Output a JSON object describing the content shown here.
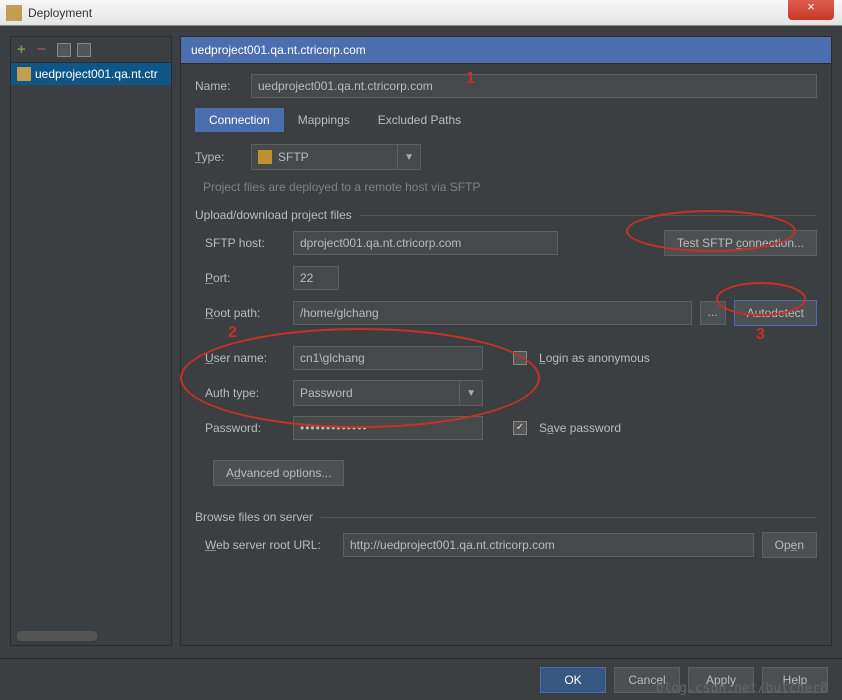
{
  "window": {
    "title": "Deployment",
    "close": "×"
  },
  "sidebar": {
    "toolbar": {
      "add": "+",
      "remove": "−"
    },
    "item": "uedproject001.qa.nt.ctr"
  },
  "header": {
    "title": "uedproject001.qa.nt.ctricorp.com"
  },
  "form": {
    "name_label": "Name:",
    "name_value": "uedproject001.qa.nt.ctricorp.com",
    "tabs": {
      "connection": "Connection",
      "mappings": "Mappings",
      "excluded": "Excluded Paths"
    },
    "type_label": "Type:",
    "type_value": "SFTP",
    "type_hint": "Project files are deployed to a remote host via SFTP",
    "upload_legend": "Upload/download project files",
    "host_label": "SFTP host:",
    "host_value": "dproject001.qa.nt.ctricorp.com",
    "test_btn": "Test SFTP connection...",
    "port_label": "Port:",
    "port_value": "22",
    "root_label": "Root path:",
    "root_value": "/home/glchang",
    "ellipsis": "...",
    "autodetect": "Autodetect",
    "user_label": "User name:",
    "user_value": "cn1\\glchang",
    "login_anon": "Login as anonymous",
    "auth_label": "Auth type:",
    "auth_value": "Password",
    "pass_label": "Password:",
    "pass_value": "•••••••••••••",
    "save_pass": "Save password",
    "advanced": "Advanced options...",
    "browse_legend": "Browse files on server",
    "web_label": "Web server root URL:",
    "web_value": "http://uedproject001.qa.nt.ctricorp.com",
    "open_btn": "Open"
  },
  "buttons": {
    "ok": "OK",
    "cancel": "Cancel",
    "apply": "Apply",
    "help": "Help"
  },
  "watermark": "blog.csdn.net/butcher8",
  "annotations": {
    "n1": "1",
    "n2": "2",
    "n3": "3"
  }
}
